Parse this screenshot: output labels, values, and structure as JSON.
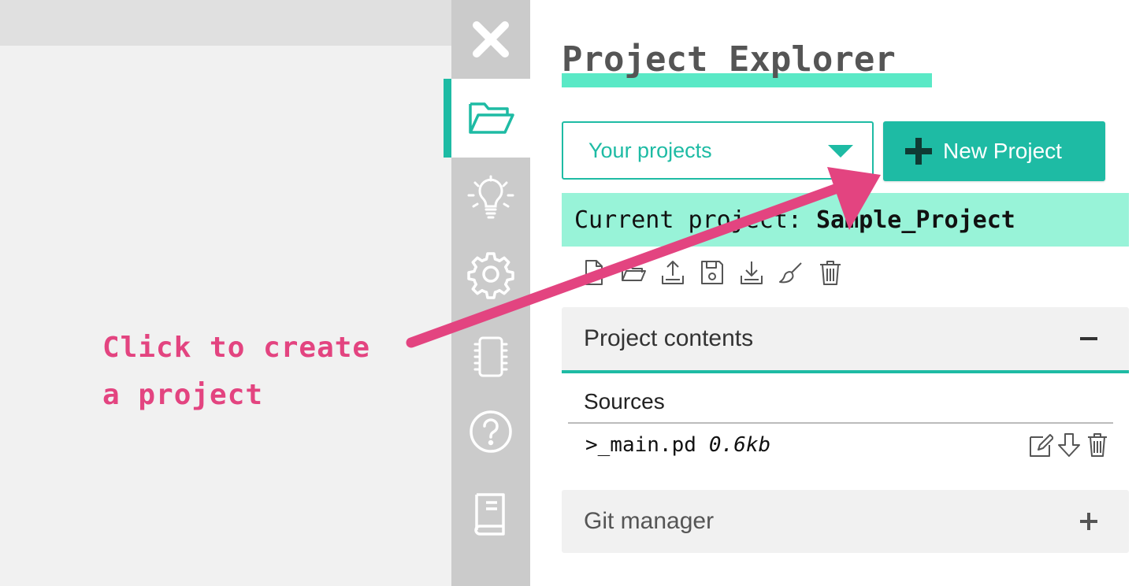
{
  "annotation": {
    "lines": [
      "Click to create",
      "a project"
    ],
    "color": "#e34480"
  },
  "rail": {
    "active": "projects",
    "items": [
      "close-icon",
      "folder-open-icon",
      "lightbulb-icon",
      "gear-icon",
      "chip-icon",
      "help-icon",
      "book-icon"
    ]
  },
  "panel": {
    "title": "Project Explorer",
    "project_select": {
      "value": "Your projects"
    },
    "new_project_label": "New Project",
    "current_project": {
      "prefix": "Current project:",
      "name": "Sample_Project"
    },
    "toolbar": [
      "new-file-icon",
      "open-folder-icon",
      "upload-icon",
      "save-icon",
      "download-icon",
      "clean-brush-icon",
      "trash-icon"
    ],
    "contents": {
      "header": "Project contents",
      "sources_label": "Sources",
      "files": [
        {
          "name": ">_main.pd",
          "size": "0.6kb"
        }
      ]
    },
    "git": {
      "header": "Git manager"
    }
  },
  "colors": {
    "accent": "#1ebba4",
    "highlight": "#98f3d8",
    "title_underline": "#5ae9c6",
    "annotation": "#e34480"
  }
}
